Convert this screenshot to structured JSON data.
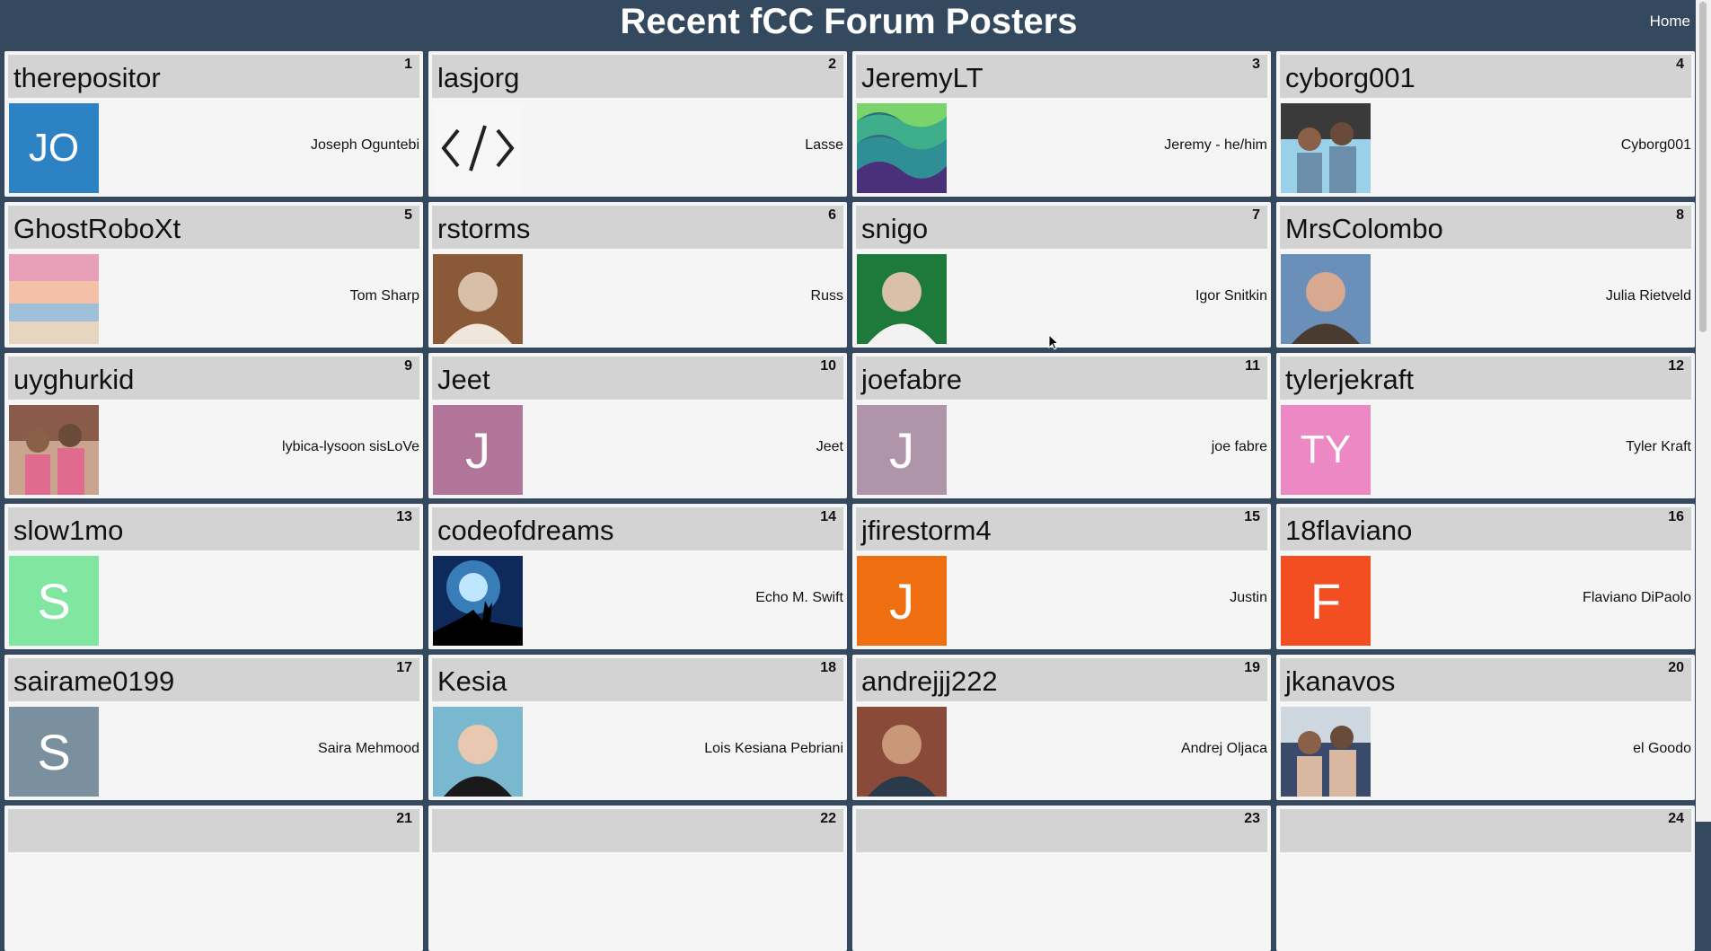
{
  "header": {
    "title": "Recent fCC Forum Posters",
    "home_label": "Home"
  },
  "posters": [
    {
      "rank": "1",
      "username": "therepositor",
      "full_name": "Joseph Oguntebi",
      "avatar": {
        "type": "initials",
        "text": "JO",
        "color": "#2d82c3"
      }
    },
    {
      "rank": "2",
      "username": "lasjorg",
      "full_name": "Lasse",
      "avatar": {
        "type": "icon",
        "icon": "code-brackets-icon"
      }
    },
    {
      "rank": "3",
      "username": "JeremyLT",
      "full_name": "Jeremy - he/him",
      "avatar": {
        "type": "photo",
        "icon": "waves-pattern",
        "colors": [
          "#2f6e7d",
          "#3fae8a",
          "#7ad36b"
        ]
      }
    },
    {
      "rank": "4",
      "username": "cyborg001",
      "full_name": "Cyborg001",
      "avatar": {
        "type": "photo",
        "icon": "graduation-photo",
        "colors": [
          "#3a3a3a",
          "#9ad1e8",
          "#6b8faa"
        ]
      }
    },
    {
      "rank": "5",
      "username": "GhostRoboXt",
      "full_name": "Tom Sharp",
      "avatar": {
        "type": "photo",
        "icon": "sunset-photo",
        "colors": [
          "#e8a0b8",
          "#f3c0a8",
          "#9fc0d8"
        ]
      }
    },
    {
      "rank": "6",
      "username": "rstorms",
      "full_name": "Russ",
      "avatar": {
        "type": "photo",
        "icon": "portrait-photo",
        "colors": [
          "#8a5a38",
          "#d8c0a8",
          "#f0e6dc"
        ]
      }
    },
    {
      "rank": "7",
      "username": "snigo",
      "full_name": "Igor Snitkin",
      "avatar": {
        "type": "photo",
        "icon": "portrait-photo",
        "colors": [
          "#1e7a3a",
          "#d9c0a8",
          "#f2f2f2"
        ]
      }
    },
    {
      "rank": "8",
      "username": "MrsColombo",
      "full_name": "Julia Rietveld",
      "avatar": {
        "type": "photo",
        "icon": "portrait-photo",
        "colors": [
          "#6a8fb8",
          "#d8a890",
          "#4a3a30"
        ]
      }
    },
    {
      "rank": "9",
      "username": "uyghurkid",
      "full_name": "lybica-lysoon sisLoVe",
      "avatar": {
        "type": "photo",
        "icon": "children-photo",
        "colors": [
          "#8a5a4a",
          "#c9a58f",
          "#e06b8f"
        ]
      }
    },
    {
      "rank": "10",
      "username": "Jeet",
      "full_name": "Jeet",
      "avatar": {
        "type": "initials",
        "text": "J",
        "color": "#b2759a"
      }
    },
    {
      "rank": "11",
      "username": "joefabre",
      "full_name": "joe fabre",
      "avatar": {
        "type": "initials",
        "text": "J",
        "color": "#b094aa"
      }
    },
    {
      "rank": "12",
      "username": "tylerjekraft",
      "full_name": "Tyler Kraft",
      "avatar": {
        "type": "initials",
        "text": "TY",
        "color": "#ec89c5"
      }
    },
    {
      "rank": "13",
      "username": "slow1mo",
      "full_name": "",
      "avatar": {
        "type": "initials",
        "text": "S",
        "color": "#80e6a0"
      }
    },
    {
      "rank": "14",
      "username": "codeofdreams",
      "full_name": "Echo M. Swift",
      "avatar": {
        "type": "photo",
        "icon": "wolf-moon-photo",
        "colors": [
          "#0a1a3a",
          "#4aa0e0",
          "#0e2a5a"
        ]
      }
    },
    {
      "rank": "15",
      "username": "jfirestorm4",
      "full_name": "Justin",
      "avatar": {
        "type": "initials",
        "text": "J",
        "color": "#ee6e10"
      }
    },
    {
      "rank": "16",
      "username": "18flaviano",
      "full_name": "Flaviano DiPaolo",
      "avatar": {
        "type": "initials",
        "text": "F",
        "color": "#f24e22"
      }
    },
    {
      "rank": "17",
      "username": "sairame0199",
      "full_name": "Saira Mehmood",
      "avatar": {
        "type": "initials",
        "text": "S",
        "color": "#7a909e"
      }
    },
    {
      "rank": "18",
      "username": "Kesia",
      "full_name": "Lois Kesiana Pebriani",
      "avatar": {
        "type": "photo",
        "icon": "portrait-photo",
        "colors": [
          "#7ab8d0",
          "#e8c8b0",
          "#1a1a1a"
        ]
      }
    },
    {
      "rank": "19",
      "username": "andrejjj222",
      "full_name": "Andrej Oljaca",
      "avatar": {
        "type": "photo",
        "icon": "portrait-photo",
        "colors": [
          "#8a4a3a",
          "#c89878",
          "#2a3a4a"
        ]
      }
    },
    {
      "rank": "20",
      "username": "jkanavos",
      "full_name": "el Goodo",
      "avatar": {
        "type": "photo",
        "icon": "family-photo",
        "colors": [
          "#cfd8e0",
          "#3a4a6a",
          "#d8b8a0"
        ]
      }
    },
    {
      "rank": "21",
      "username": "",
      "full_name": "",
      "avatar": {
        "type": "none"
      }
    },
    {
      "rank": "22",
      "username": "",
      "full_name": "",
      "avatar": {
        "type": "none"
      }
    },
    {
      "rank": "23",
      "username": "",
      "full_name": "",
      "avatar": {
        "type": "none"
      }
    },
    {
      "rank": "24",
      "username": "",
      "full_name": "",
      "avatar": {
        "type": "none"
      }
    }
  ]
}
